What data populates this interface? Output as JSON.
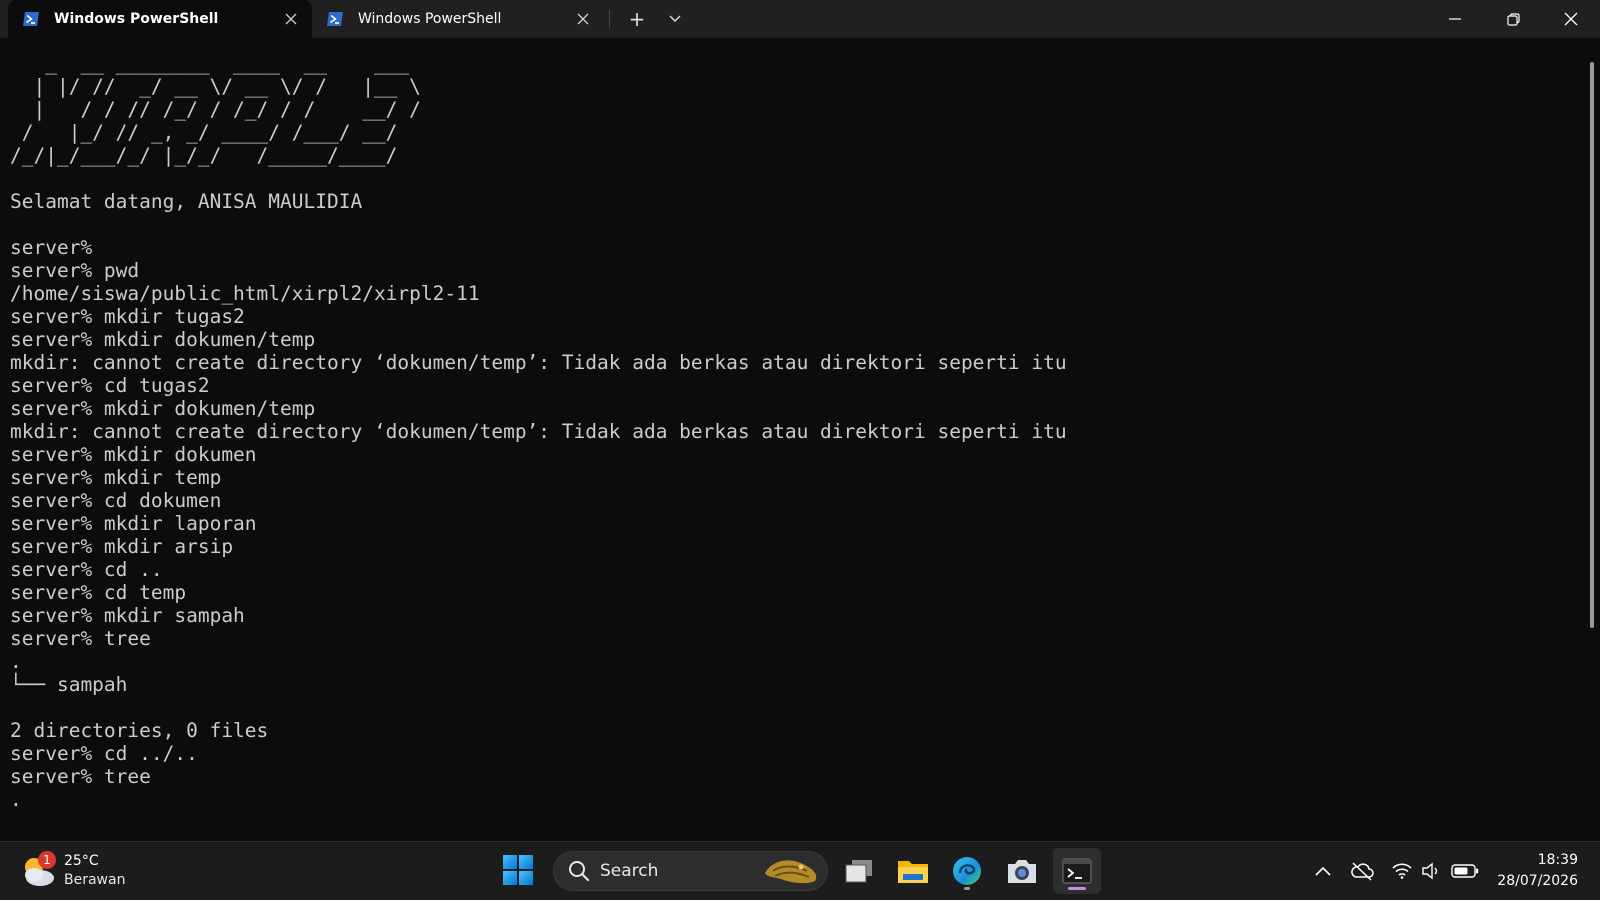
{
  "titlebar": {
    "tabs": [
      {
        "label": "Windows PowerShell",
        "active": true
      },
      {
        "label": "Windows PowerShell",
        "active": false
      }
    ],
    "new_tab_symbol": "+",
    "accent_color": "#0c0c0c"
  },
  "terminal": {
    "foreground": "#cccccc",
    "background": "#0c0c0c",
    "lines": [
      "   _  __ ________  ____  __    ___",
      "  | |/ //  _/ __ \\/ __ \\/ /   |__ \\",
      "  |   / / // /_/ / /_/ / /    __/ /",
      " /   |_/ // _, _/ ____/ /___/ __/",
      "/_/|_/___/_/ |_/_/   /_____/____/",
      "",
      "Selamat datang, ANISA MAULIDIA",
      "",
      "server%",
      "server% pwd",
      "/home/siswa/public_html/xirpl2/xirpl2-11",
      "server% mkdir tugas2",
      "server% mkdir dokumen/temp",
      "mkdir: cannot create directory ‘dokumen/temp’: Tidak ada berkas atau direktori seperti itu",
      "server% cd tugas2",
      "server% mkdir dokumen/temp",
      "mkdir: cannot create directory ‘dokumen/temp’: Tidak ada berkas atau direktori seperti itu",
      "server% mkdir dokumen",
      "server% mkdir temp",
      "server% cd dokumen",
      "server% mkdir laporan",
      "server% mkdir arsip",
      "server% cd ..",
      "server% cd temp",
      "server% mkdir sampah",
      "server% tree",
      ".",
      "└── sampah",
      "",
      "2 directories, 0 files",
      "server% cd ../..",
      "server% tree",
      "."
    ]
  },
  "taskbar": {
    "weather": {
      "temperature": "25°C",
      "description": "Berawan",
      "badge_count": "1"
    },
    "search": {
      "placeholder": "Search"
    },
    "apps": [
      {
        "icon": "task-view-icon"
      },
      {
        "icon": "file-explorer-icon"
      },
      {
        "icon": "edge-icon"
      },
      {
        "icon": "camera-icon"
      },
      {
        "icon": "terminal-icon",
        "active": true
      }
    ],
    "clock": {
      "time": "18:39",
      "date": "28/07/2026"
    },
    "accent_color": "#c88be8"
  }
}
